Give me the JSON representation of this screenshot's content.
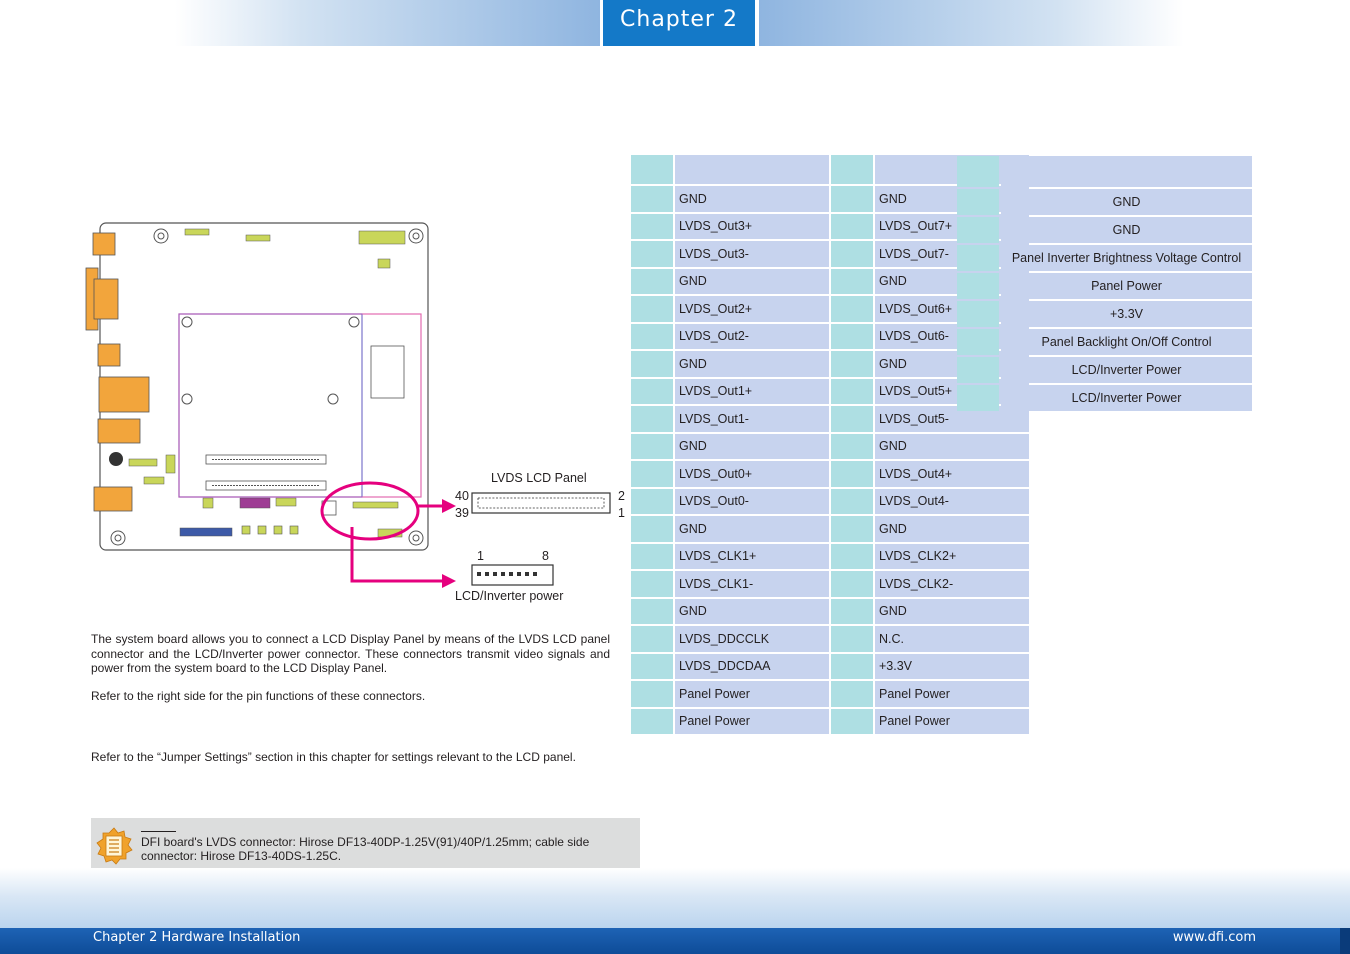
{
  "header": {
    "chapter_label": "Chapter 2"
  },
  "diagram": {
    "lvds_label": "LVDS LCD Panel",
    "lvds_pin_top_left": "40",
    "lvds_pin_bottom_left": "39",
    "lvds_pin_top_right": "2",
    "lvds_pin_bottom_right": "1",
    "inv_pin_left": "1",
    "inv_pin_right": "8",
    "inv_label": "LCD/Inverter power"
  },
  "lvds_table": {
    "rows": [
      [
        "",
        "GND",
        "",
        "GND"
      ],
      [
        "",
        "LVDS_Out3+",
        "",
        "LVDS_Out7+"
      ],
      [
        "",
        "LVDS_Out3-",
        "",
        "LVDS_Out7-"
      ],
      [
        "",
        "GND",
        "",
        "GND"
      ],
      [
        "",
        "LVDS_Out2+",
        "",
        "LVDS_Out6+"
      ],
      [
        "",
        "LVDS_Out2-",
        "",
        "LVDS_Out6-"
      ],
      [
        "",
        "GND",
        "",
        "GND"
      ],
      [
        "",
        "LVDS_Out1+",
        "",
        "LVDS_Out5+"
      ],
      [
        "",
        "LVDS_Out1-",
        "",
        "LVDS_Out5-"
      ],
      [
        "",
        "GND",
        "",
        "GND"
      ],
      [
        "",
        "LVDS_Out0+",
        "",
        "LVDS_Out4+"
      ],
      [
        "",
        "LVDS_Out0-",
        "",
        "LVDS_Out4-"
      ],
      [
        "",
        "GND",
        "",
        "GND"
      ],
      [
        "",
        "LVDS_CLK1+",
        "",
        "LVDS_CLK2+"
      ],
      [
        "",
        "LVDS_CLK1-",
        "",
        "LVDS_CLK2-"
      ],
      [
        "",
        "GND",
        "",
        "GND"
      ],
      [
        "",
        "LVDS_DDCCLK",
        "",
        "N.C."
      ],
      [
        "",
        "LVDS_DDCDAA",
        "",
        "+3.3V"
      ],
      [
        "",
        "Panel Power",
        "",
        "Panel Power"
      ],
      [
        "",
        "Panel Power",
        "",
        "Panel Power"
      ]
    ]
  },
  "inverter_table": {
    "rows": [
      [
        "",
        "GND"
      ],
      [
        "",
        "GND"
      ],
      [
        "",
        "Panel Inverter Brightness Voltage Control"
      ],
      [
        "",
        "Panel Power"
      ],
      [
        "",
        "+3.3V"
      ],
      [
        "",
        "Panel Backlight On/Off Control"
      ],
      [
        "",
        "LCD/Inverter Power"
      ],
      [
        "",
        "LCD/Inverter Power"
      ]
    ]
  },
  "text": {
    "p1": "The system board allows you to connect a LCD Display Panel by means of the LVDS LCD panel connector and the LCD/Inverter power connector. These connectors transmit video signals and power from the system board to the LCD Display Panel.",
    "p2": "Refer to the right side for the pin functions of these connectors.",
    "p3": "Refer to the “Jumper Settings” section in this chapter for settings relevant to the LCD panel."
  },
  "note": {
    "text": "DFI board's LVDS connector: Hirose DF13-40DP-1.25V(91)/40P/1.25mm; cable side connector: Hirose DF13-40DS-1.25C."
  },
  "footer": {
    "left": "Chapter 2 Hardware Installation",
    "right": "www.dfi.com"
  },
  "colors": {
    "header_blue": "#1479c8",
    "highlight_magenta": "#e5007e",
    "pin_cell": "#aedfe3",
    "signal_cell": "#c7d3ee",
    "note_accent": "#e2a02a"
  }
}
